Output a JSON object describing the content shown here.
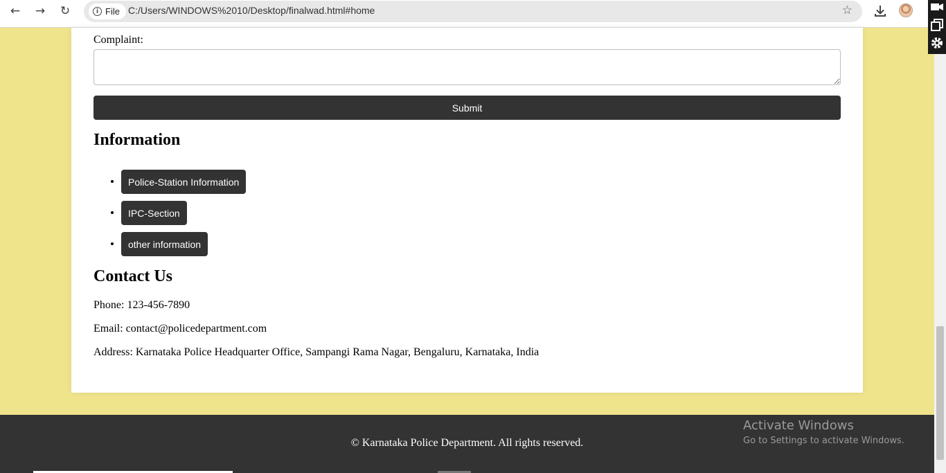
{
  "browser": {
    "back_glyph": "←",
    "forward_glyph": "→",
    "reload_glyph": "↻",
    "site_chip_label": "File",
    "url": "C:/Users/WINDOWS%2010/Desktop/finalwad.html#home",
    "bookmark_glyph": "☆"
  },
  "form": {
    "complaint_label": "Complaint:",
    "complaint_value": "",
    "submit_label": "Submit"
  },
  "information": {
    "heading": "Information",
    "items": [
      {
        "label": "Police-Station Information"
      },
      {
        "label": "IPC-Section"
      },
      {
        "label": "other information"
      }
    ]
  },
  "contact": {
    "heading": "Contact Us",
    "phone": "Phone: 123-456-7890",
    "email": "Email: contact@policedepartment.com",
    "address": "Address: Karnataka Police Headquarter Office, Sampangi Rama Nagar, Bengaluru, Karnataka, India"
  },
  "footer": {
    "copyright": "© Karnataka Police Department. All rights reserved."
  },
  "watermark": {
    "title": "Activate Windows",
    "subtitle": "Go to Settings to activate Windows."
  },
  "colors": {
    "page_background": "#efe48b",
    "button_dark": "#333333",
    "footer_background": "#333333"
  }
}
